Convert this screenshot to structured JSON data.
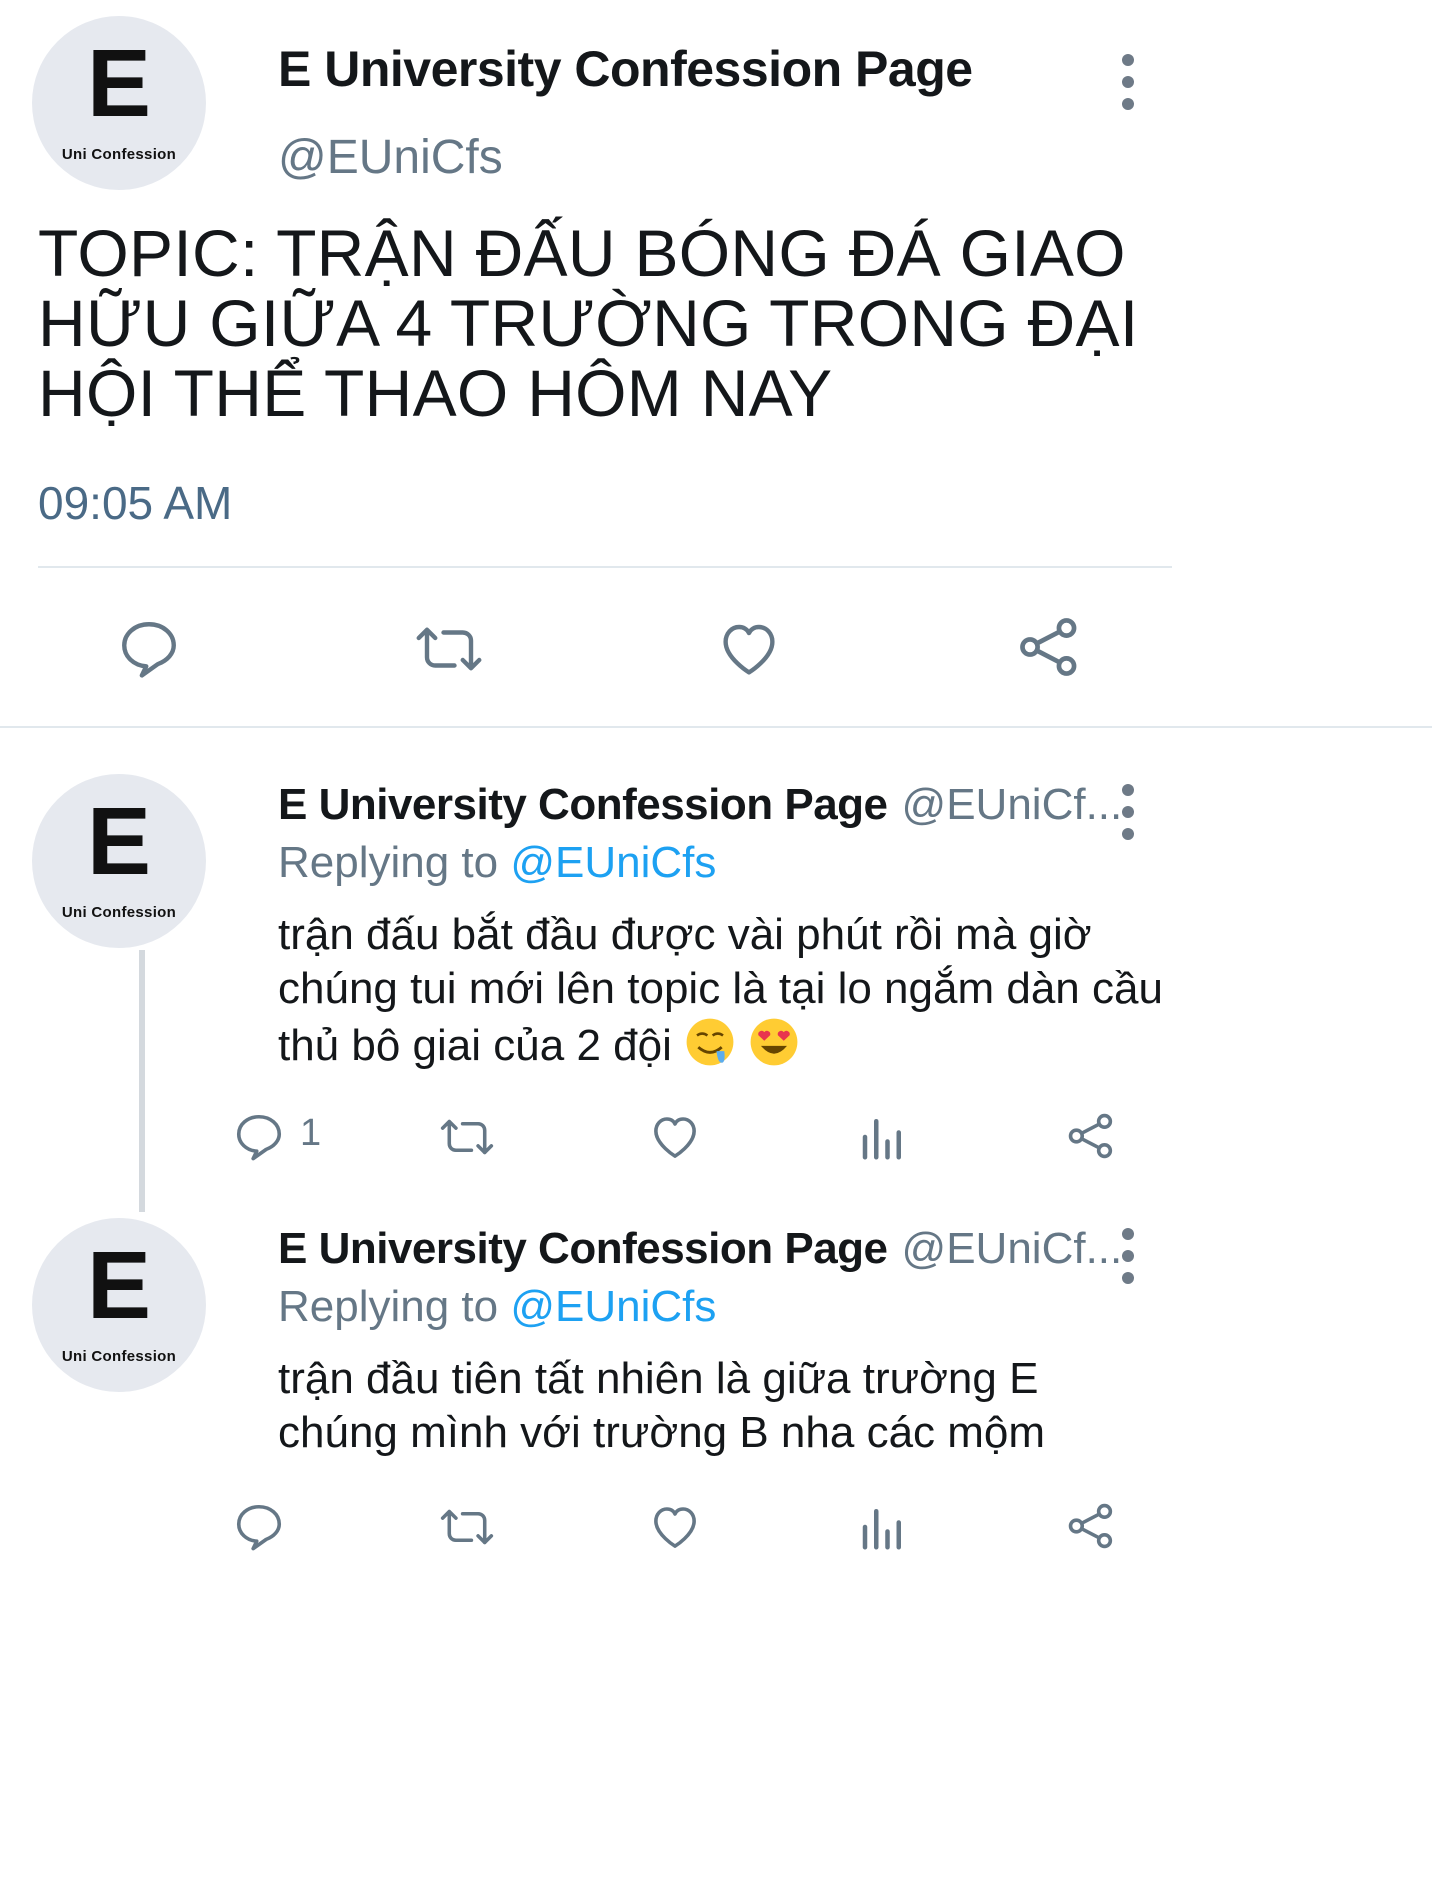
{
  "account": {
    "name": "E University Confession Page",
    "handle": "@EUniCfs",
    "handle_truncated": "@EUniCf...",
    "avatar_letter": "E",
    "avatar_caption": "Uni Confession"
  },
  "main_tweet": {
    "text": "TOPIC: TRẬN ĐẤU BÓNG ĐÁ GIAO HỮU GIỮA 4 TRƯỜNG TRONG ĐẠI HỘI THỂ THAO HÔM NAY",
    "time": "09:05 AM"
  },
  "replies": [
    {
      "replying_prefix": "Replying to",
      "replying_to": "@EUniCfs",
      "text": "trận đấu bắt đầu được vài phút rồi mà giờ chúng tui mới lên topic là tại lo ngắm dàn cầu thủ bô giai của 2 đội",
      "emojis": [
        "drooling-face",
        "heart-eyes"
      ],
      "reply_count": "1"
    },
    {
      "replying_prefix": "Replying to",
      "replying_to": "@EUniCfs",
      "text": "trận đầu tiên tất nhiên là giữa trường E chúng mình với trường B nha các mộm",
      "reply_count": ""
    }
  ],
  "icons": [
    "reply-icon",
    "retweet-icon",
    "like-icon",
    "share-icon",
    "analytics-icon",
    "more-icon"
  ],
  "colors": {
    "text": "#14171a",
    "secondary": "#657786",
    "link": "#1da1f2",
    "icon": "#657786",
    "avatar_bg": "#e6e9ef",
    "divider": "#e1e8ed"
  }
}
